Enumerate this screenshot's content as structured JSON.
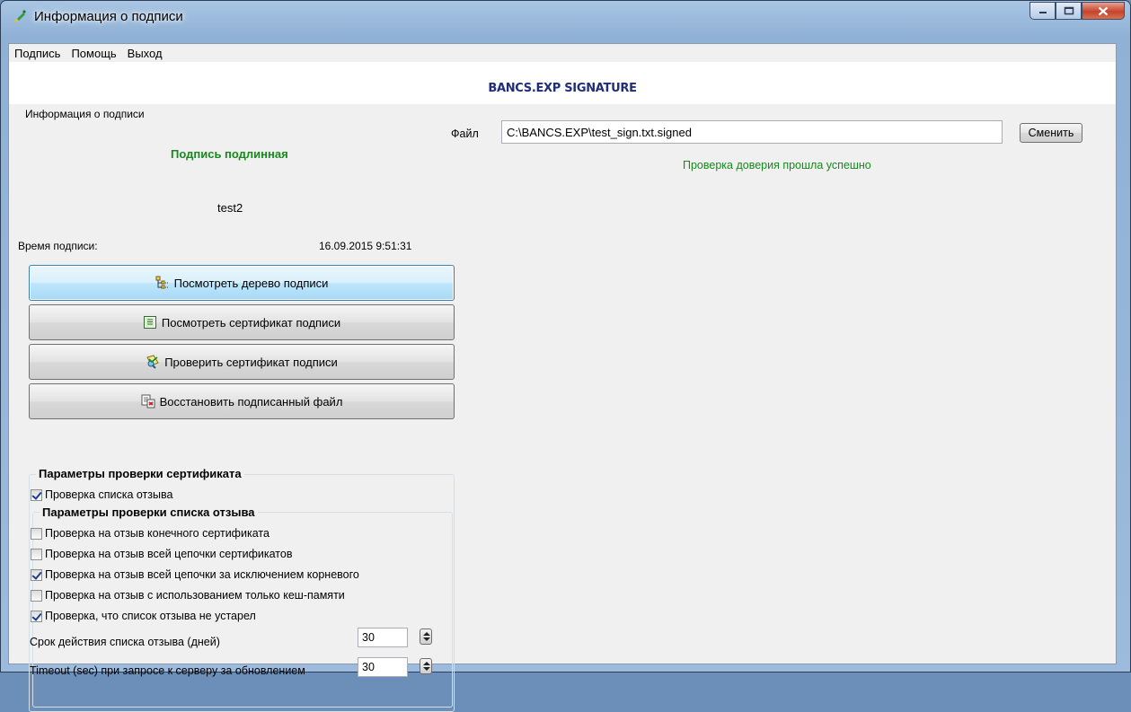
{
  "window": {
    "title": "Информация о подписи"
  },
  "menu": {
    "items": [
      "Подпись",
      "Помощь",
      "Выход"
    ]
  },
  "banner": {
    "title": "BANCS.EXP SIGNATURE"
  },
  "signature_info": {
    "group_label": "Информация о подписи",
    "status": "Подпись подлинная",
    "signer": "test2",
    "time_label": "Время подписи:",
    "time_value": "16.09.2015 9:51:31"
  },
  "actions": {
    "view_tree": "Посмотреть дерево подписи",
    "view_cert": "Посмотреть сертификат подписи",
    "verify_cert": "Проверить сертификат подписи",
    "restore_file": "Восстановить подписанный файл"
  },
  "cert_params": {
    "title": "Параметры проверки сертификата",
    "crl_check": {
      "label": "Проверка списка отзыва",
      "checked": true
    }
  },
  "crl_params": {
    "title": "Параметры проверки списка отзыва",
    "options": [
      {
        "label": "Проверка на отзыв конечного сертификата",
        "checked": false
      },
      {
        "label": "Проверка на отзыв всей цепочки сертификатов",
        "checked": false
      },
      {
        "label": "Проверка на отзыв всей цепочки за исключением корневого",
        "checked": true
      },
      {
        "label": "Проверка на отзыв с использованием только кеш-памяти",
        "checked": false
      },
      {
        "label": "Проверка, что список отзыва не устарел",
        "checked": true
      }
    ],
    "validity_label": "Срок действия списка отзыва (дней)",
    "validity_value": "30",
    "timeout_label": "Timeout (sec) при запросе к серверу за обновлением",
    "timeout_value": "30"
  },
  "file": {
    "label": "Файл",
    "path": "C:\\BANCS.EXP\\test_sign.txt.signed",
    "change_label": "Сменить",
    "trust_status": "Проверка доверия прошла успешно"
  },
  "colors": {
    "ok_green": "#17891f",
    "banner_blue": "#1f2d7a"
  }
}
